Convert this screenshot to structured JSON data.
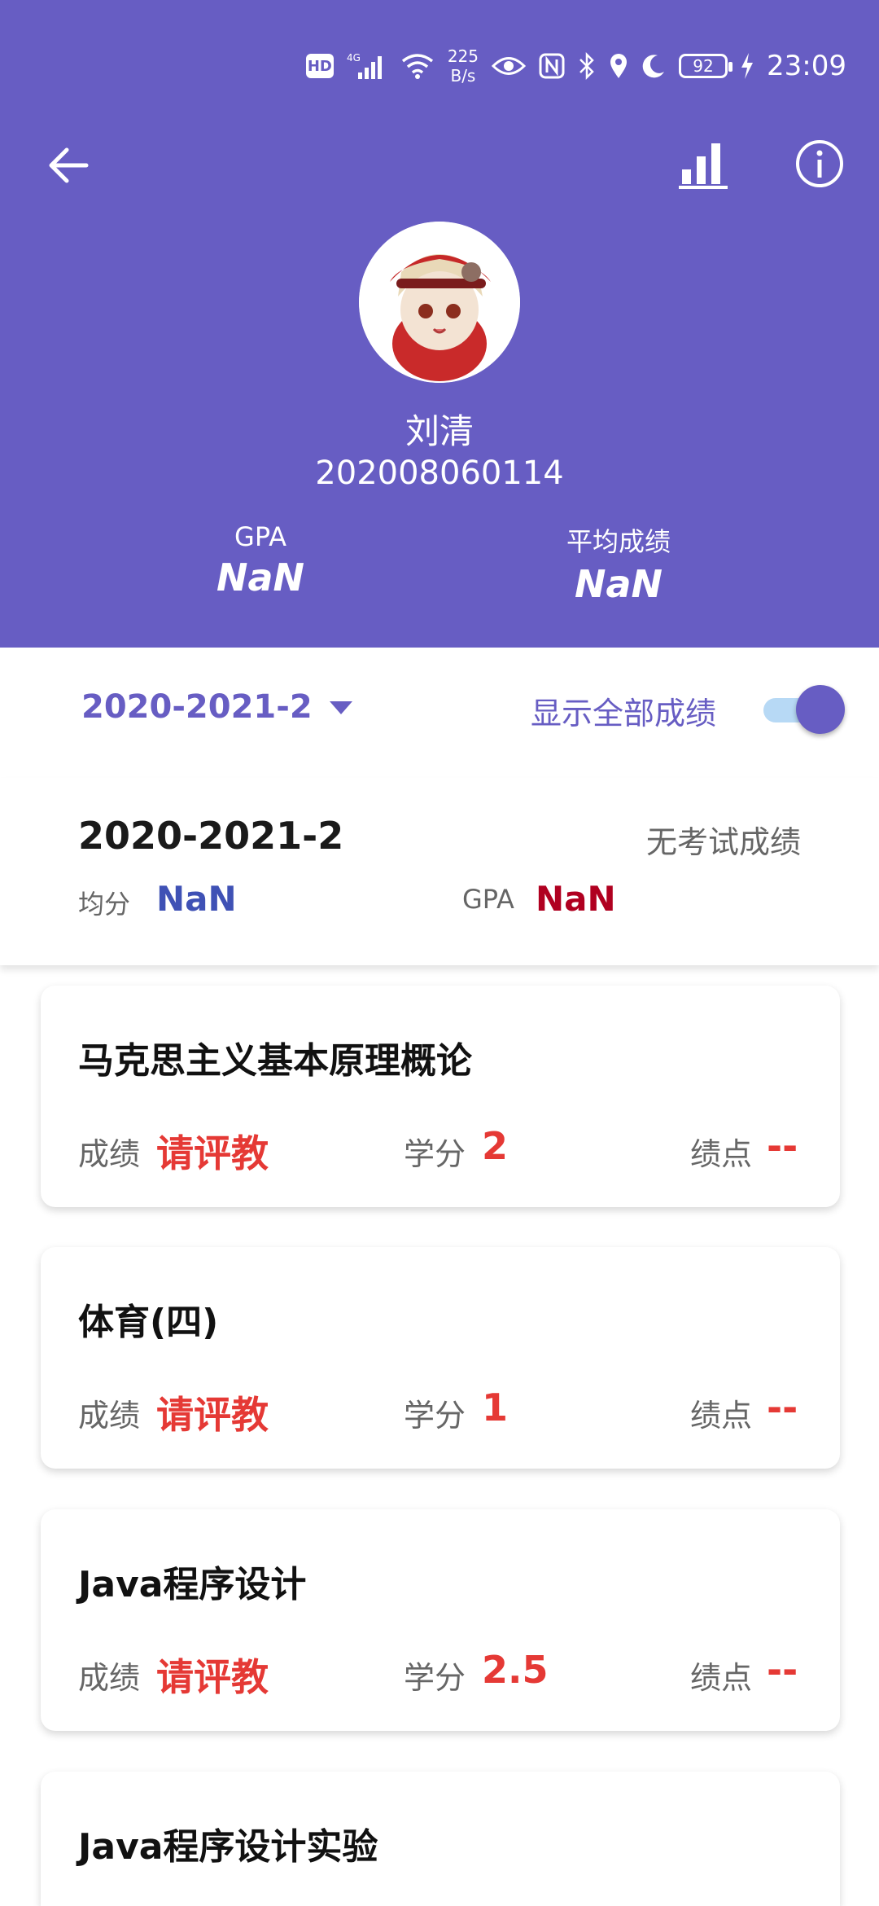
{
  "status_bar": {
    "hd": "HD",
    "signal": "4G",
    "net_speed_value": "225",
    "net_speed_unit": "B/s",
    "battery": "92",
    "time": "23:09"
  },
  "profile": {
    "name": "刘清",
    "student_id": "202008060114",
    "gpa_label": "GPA",
    "gpa_value": "NaN",
    "avg_label": "平均成绩",
    "avg_value": "NaN"
  },
  "filter": {
    "semester": "2020-2021-2",
    "show_all_label": "显示全部成绩",
    "show_all_enabled": true
  },
  "summary": {
    "semester": "2020-2021-2",
    "status": "无考试成绩",
    "avg_label": "均分",
    "avg_value": "NaN",
    "gpa_label": "GPA",
    "gpa_value": "NaN"
  },
  "labels": {
    "score": "成绩",
    "credit": "学分",
    "point": "绩点"
  },
  "courses": [
    {
      "name": "马克思主义基本原理概论",
      "score": "请评教",
      "credit": "2",
      "point": "--"
    },
    {
      "name": "体育(四)",
      "score": "请评教",
      "credit": "1",
      "point": "--"
    },
    {
      "name": "Java程序设计",
      "score": "请评教",
      "credit": "2.5",
      "point": "--"
    },
    {
      "name": "Java程序设计实验"
    }
  ],
  "colors": {
    "primary": "#675DC3",
    "accent_red": "#E53935",
    "avg_blue": "#3F51B5",
    "gpa_red": "#B00020"
  }
}
